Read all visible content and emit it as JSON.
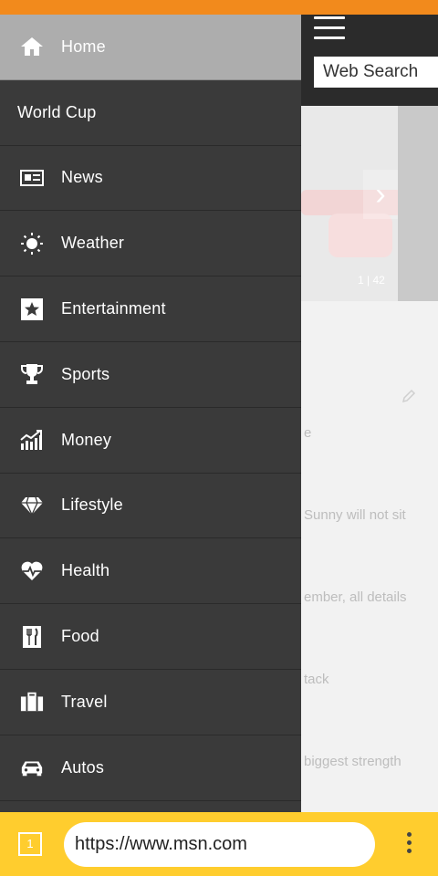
{
  "header": {
    "search_label": "Web Search",
    "hero_counter": "1 | 42"
  },
  "background_stories": [
    "e",
    "Sunny will not sit",
    "ember, all details",
    "tack",
    "biggest strength"
  ],
  "drawer": {
    "items": [
      {
        "label": "Home",
        "icon": "home-icon",
        "active": true
      },
      {
        "label": "World Cup",
        "icon": "",
        "active": false
      },
      {
        "label": "News",
        "icon": "news-icon",
        "active": false
      },
      {
        "label": "Weather",
        "icon": "sun-icon",
        "active": false
      },
      {
        "label": "Entertainment",
        "icon": "star-icon",
        "active": false
      },
      {
        "label": "Sports",
        "icon": "trophy-icon",
        "active": false
      },
      {
        "label": "Money",
        "icon": "chart-icon",
        "active": false
      },
      {
        "label": "Lifestyle",
        "icon": "diamond-icon",
        "active": false
      },
      {
        "label": "Health",
        "icon": "heart-pulse-icon",
        "active": false
      },
      {
        "label": "Food",
        "icon": "fork-knife-icon",
        "active": false
      },
      {
        "label": "Travel",
        "icon": "suitcase-icon",
        "active": false
      },
      {
        "label": "Autos",
        "icon": "car-icon",
        "active": false
      }
    ]
  },
  "browser": {
    "tab_count": "1",
    "url": "https://www.msn.com"
  },
  "colors": {
    "status_bar": "#f28a1c",
    "drawer_bg": "#3a3a3a",
    "active_item": "#adadad",
    "bottom_bar": "#ffcd2e"
  }
}
